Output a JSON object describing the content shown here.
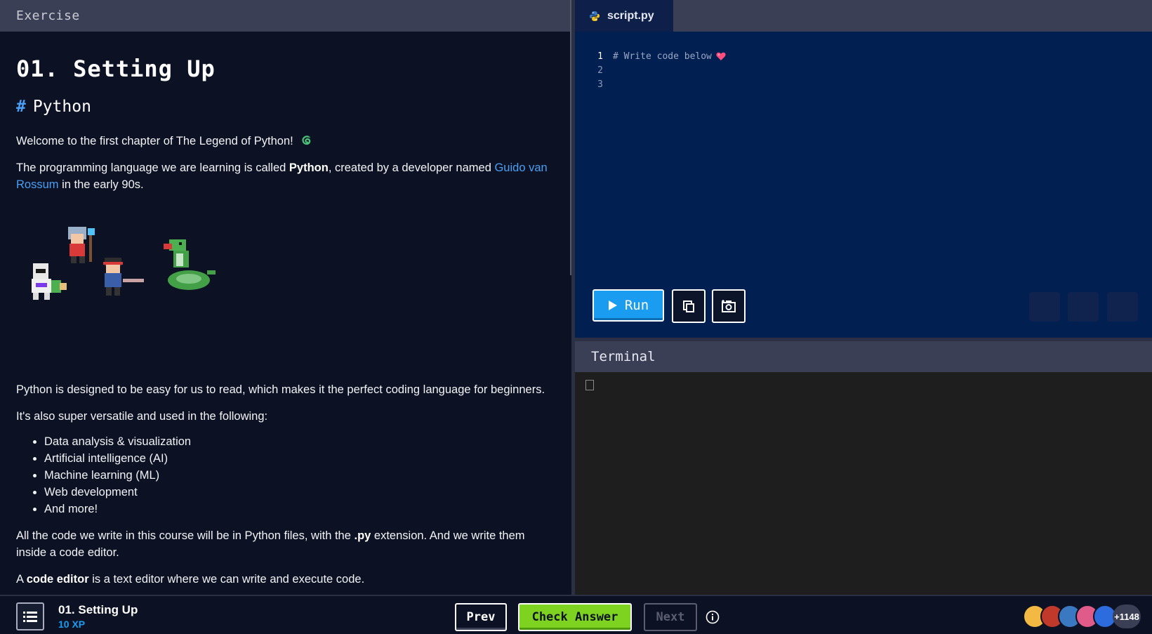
{
  "exercise_panel": {
    "header": "Exercise",
    "title": "01. Setting Up",
    "section_heading": "Python",
    "intro": "Welcome to the first chapter of The Legend of Python!",
    "p2_before": "The programming language we are learning is called ",
    "p2_bold": "Python",
    "p2_middle": ", created by a developer named ",
    "p2_link": "Guido van Rossum",
    "p2_after": " in the early 90s.",
    "p3": "Python is designed to be easy for us to read, which makes it the perfect coding language for beginners.",
    "p4": "It's also super versatile and used in the following:",
    "bullets": [
      "Data analysis & visualization",
      "Artificial intelligence (AI)",
      "Machine learning (ML)",
      "Web development",
      "And more!"
    ],
    "p5_before": "All the code we write in this course will be in Python files, with the ",
    "p5_bold": ".py",
    "p5_after": " extension. And we write them inside a code editor.",
    "p6_before": "A ",
    "p6_bold": "code editor",
    "p6_after": " is a text editor where we can write and execute code."
  },
  "editor": {
    "tab_label": "script.py",
    "lines": [
      {
        "number": "1",
        "text": "# Write code below"
      },
      {
        "number": "2",
        "text": ""
      },
      {
        "number": "3",
        "text": ""
      }
    ],
    "run_label": "Run"
  },
  "terminal": {
    "header": "Terminal"
  },
  "footer": {
    "lesson_title": "01. Setting Up",
    "lesson_xp": "10 XP",
    "prev_label": "Prev",
    "check_label": "Check Answer",
    "next_label": "Next",
    "online_count": "+1148"
  },
  "colors": {
    "accent_blue": "#1a9cf0",
    "check_green": "#7ed321",
    "editor_bg": "#011f51",
    "panel_bg": "#0c1223"
  },
  "icons": [
    "python-icon",
    "play-icon",
    "copy-icon",
    "snapshot-icon",
    "menu-list-icon",
    "info-icon",
    "heart-icon",
    "snake-icon"
  ]
}
